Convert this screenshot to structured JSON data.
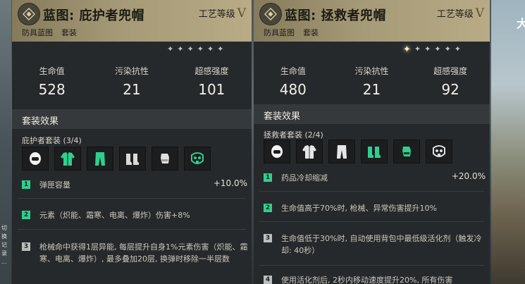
{
  "panels": [
    {
      "title": "蓝图: 庇护者兜帽",
      "tier_label": "工艺等级",
      "tier_value": "V",
      "tags": [
        "防具蓝图",
        "套装"
      ],
      "stars": [
        "✦",
        "✦",
        "✦",
        "✦",
        "✦",
        "✦"
      ],
      "stats": [
        {
          "label": "生命值",
          "value": "528"
        },
        {
          "label": "污染抗性",
          "value": "21"
        },
        {
          "label": "超感强度",
          "value": "101"
        }
      ],
      "section_title": "套装效果",
      "set_name": "庇护者套装 (3/4)",
      "icons": [
        "hood-icon",
        "jacket-icon",
        "pants-icon",
        "boots-icon",
        "gloves-icon",
        "mask-icon"
      ],
      "effects": [
        {
          "num": "1",
          "text": "弹匣容量",
          "value": "+10.0%"
        },
        {
          "num": "2",
          "text": "元素（炽能、霜寒、电离、爆炸）伤害+8%",
          "value": ""
        },
        {
          "num": "3",
          "text": "枪械命中获得1层异能, 每层提升自身1%元素伤害（炽能、霜寒、电离、爆炸）, 最多叠加20层, 换弹时移除一半层数",
          "value": ""
        }
      ]
    },
    {
      "title": "蓝图: 拯救者兜帽",
      "tier_label": "工艺等级",
      "tier_value": "V",
      "tags": [
        "防具蓝图",
        "套装"
      ],
      "stars": [
        "✦",
        "✦",
        "✦",
        "✦",
        "✦",
        "✦"
      ],
      "stats": [
        {
          "label": "生命值",
          "value": "480"
        },
        {
          "label": "污染抗性",
          "value": "21"
        },
        {
          "label": "超感强度",
          "value": "92"
        }
      ],
      "section_title": "套装效果",
      "set_name": "拯救者套装 (2/4)",
      "icons": [
        "hood-icon",
        "jacket-icon",
        "pants-icon",
        "boots-icon",
        "gloves-icon",
        "mask-icon"
      ],
      "effects": [
        {
          "num": "1",
          "text": "药品冷却缩减",
          "value": "+20.0%"
        },
        {
          "num": "2",
          "text": "生命值高于70%时, 枪械、异常伤害提升10%",
          "value": ""
        },
        {
          "num": "3",
          "text": "生命值低于30%时, 自动使用背包中最低级活化剂（触发冷却: 40秒）",
          "value": ""
        },
        {
          "num": "4",
          "text": "使用活化剂后, 2秒内移动速度提升20%, 所有伤害",
          "value": ""
        }
      ]
    }
  ],
  "background": {
    "right_text": "大",
    "left_text": "切换 记录 ..."
  },
  "colors": {
    "accent_green": "#2fcf8f",
    "header_gold": "#a59a77",
    "panel_bg": "#26292b"
  }
}
